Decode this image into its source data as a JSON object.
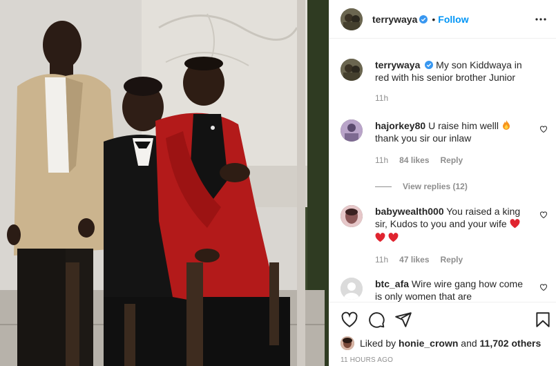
{
  "post": {
    "author": "terrywaya",
    "follow_label": "Follow",
    "separator": "•",
    "caption": "My son Kiddwaya in red with his senior brother Junior",
    "caption_time": "11h"
  },
  "comments": [
    {
      "username": "hajorkey80",
      "text_line1": "U raise him welll",
      "text_line2": "thank you sir our inlaw",
      "time": "11h",
      "likes": "84 likes",
      "reply_label": "Reply",
      "emoji_icon": "fire-icon"
    },
    {
      "username": "babywealth000",
      "text": "You raised a king sir, Kudos to you and your wife",
      "time": "11h",
      "likes": "47 likes",
      "reply_label": "Reply",
      "emoji_icon": "red-heart-icon"
    },
    {
      "username": "btc_afa",
      "text": "Wire wire gang how come is only women that are"
    }
  ],
  "view_replies": "View replies (12)",
  "likes_summary": {
    "prefix": "Liked by",
    "user": "honie_crown",
    "middle": "and",
    "count": "11,702 others"
  },
  "timestamp": "11 HOURS AGO",
  "colors": {
    "accent": "#0095f6",
    "text": "#262626",
    "muted": "#8e8e8e",
    "heart": "#ed4956"
  }
}
